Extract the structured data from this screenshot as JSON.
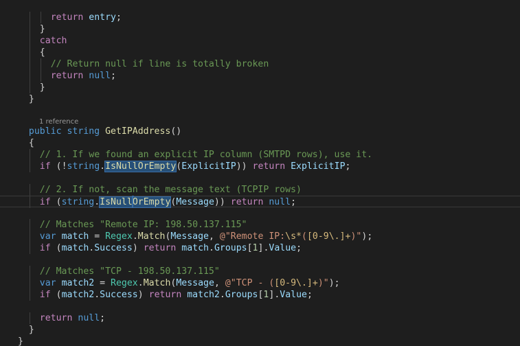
{
  "editor": {
    "codelens": "1 reference",
    "lines": [
      {
        "indent": 6,
        "tokens": [
          [
            "ctl",
            "return"
          ],
          [
            "pl",
            " "
          ],
          [
            "var",
            "entry"
          ],
          [
            "pl",
            ";"
          ]
        ]
      },
      {
        "indent": 4,
        "tokens": [
          [
            "pl",
            "}"
          ]
        ]
      },
      {
        "indent": 4,
        "tokens": [
          [
            "ctl",
            "catch"
          ]
        ]
      },
      {
        "indent": 4,
        "tokens": [
          [
            "pl",
            "{"
          ]
        ]
      },
      {
        "indent": 6,
        "tokens": [
          [
            "cm",
            "// Return null if line is totally broken"
          ]
        ]
      },
      {
        "indent": 6,
        "tokens": [
          [
            "ctl",
            "return"
          ],
          [
            "pl",
            " "
          ],
          [
            "kw",
            "null"
          ],
          [
            "pl",
            ";"
          ]
        ]
      },
      {
        "indent": 4,
        "tokens": [
          [
            "pl",
            "}"
          ]
        ]
      },
      {
        "indent": 2,
        "tokens": [
          [
            "pl",
            "}"
          ]
        ]
      },
      {
        "indent": 0,
        "tokens": []
      },
      {
        "indent": 0,
        "tokens": []
      },
      {
        "indent": 2,
        "tokens": [
          [
            "kw",
            "public"
          ],
          [
            "pl",
            " "
          ],
          [
            "kw",
            "string"
          ],
          [
            "pl",
            " "
          ],
          [
            "fn",
            "GetIPAddress"
          ],
          [
            "pl",
            "()"
          ]
        ]
      },
      {
        "indent": 2,
        "tokens": [
          [
            "pl",
            "{"
          ]
        ]
      },
      {
        "indent": 4,
        "tokens": [
          [
            "cm",
            "// 1. If we found an explicit IP column (SMTPD rows), use it."
          ]
        ]
      },
      {
        "indent": 4,
        "tokens": [
          [
            "ctl",
            "if"
          ],
          [
            "pl",
            " (!"
          ],
          [
            "kw",
            "string"
          ],
          [
            "pl",
            "."
          ],
          [
            "fn hl",
            "IsNullOrEmpty"
          ],
          [
            "pl",
            "("
          ],
          [
            "var",
            "ExplicitIP"
          ],
          [
            "pl",
            ")) "
          ],
          [
            "ctl",
            "return"
          ],
          [
            "pl",
            " "
          ],
          [
            "var",
            "ExplicitIP"
          ],
          [
            "pl",
            ";"
          ]
        ]
      },
      {
        "indent": 0,
        "tokens": []
      },
      {
        "indent": 4,
        "tokens": [
          [
            "cm",
            "// 2. If not, scan the message text (TCPIP rows)"
          ]
        ]
      },
      {
        "indent": 4,
        "current": true,
        "tokens": [
          [
            "ctl",
            "if"
          ],
          [
            "pl",
            " ("
          ],
          [
            "kw",
            "string"
          ],
          [
            "pl",
            "."
          ],
          [
            "fn hl",
            "IsNull"
          ],
          [
            "caret",
            ""
          ],
          [
            "fn hl",
            "OrEmpty"
          ],
          [
            "pl",
            "("
          ],
          [
            "var",
            "Message"
          ],
          [
            "pl",
            ")) "
          ],
          [
            "ctl",
            "return"
          ],
          [
            "pl",
            " "
          ],
          [
            "kw",
            "null"
          ],
          [
            "pl",
            ";"
          ]
        ]
      },
      {
        "indent": 0,
        "tokens": []
      },
      {
        "indent": 4,
        "tokens": [
          [
            "cm",
            "// Matches \"Remote IP: 198.50.137.115\""
          ]
        ]
      },
      {
        "indent": 4,
        "tokens": [
          [
            "kw",
            "var"
          ],
          [
            "pl",
            " "
          ],
          [
            "var",
            "match"
          ],
          [
            "pl",
            " = "
          ],
          [
            "ty",
            "Regex"
          ],
          [
            "pl",
            "."
          ],
          [
            "fn",
            "Match"
          ],
          [
            "pl",
            "("
          ],
          [
            "var",
            "Message"
          ],
          [
            "pl",
            ", "
          ],
          [
            "str",
            "@\"Remote IP:"
          ],
          [
            "esc",
            "\\s*"
          ],
          [
            "str",
            "("
          ],
          [
            "esc",
            "[0-9\\.]+"
          ],
          [
            "str",
            ")\""
          ],
          [
            "pl",
            ");"
          ]
        ]
      },
      {
        "indent": 4,
        "tokens": [
          [
            "ctl",
            "if"
          ],
          [
            "pl",
            " ("
          ],
          [
            "var",
            "match"
          ],
          [
            "pl",
            "."
          ],
          [
            "var",
            "Success"
          ],
          [
            "pl",
            ") "
          ],
          [
            "ctl",
            "return"
          ],
          [
            "pl",
            " "
          ],
          [
            "var",
            "match"
          ],
          [
            "pl",
            "."
          ],
          [
            "var",
            "Groups"
          ],
          [
            "pl",
            "["
          ],
          [
            "num",
            "1"
          ],
          [
            "pl",
            "]."
          ],
          [
            "var",
            "Value"
          ],
          [
            "pl",
            ";"
          ]
        ]
      },
      {
        "indent": 0,
        "tokens": []
      },
      {
        "indent": 4,
        "tokens": [
          [
            "cm",
            "// Matches \"TCP - 198.50.137.115\""
          ]
        ]
      },
      {
        "indent": 4,
        "tokens": [
          [
            "kw",
            "var"
          ],
          [
            "pl",
            " "
          ],
          [
            "var",
            "match2"
          ],
          [
            "pl",
            " = "
          ],
          [
            "ty",
            "Regex"
          ],
          [
            "pl",
            "."
          ],
          [
            "fn",
            "Match"
          ],
          [
            "pl",
            "("
          ],
          [
            "var",
            "Message"
          ],
          [
            "pl",
            ", "
          ],
          [
            "str",
            "@\"TCP - ("
          ],
          [
            "esc",
            "[0-9\\.]+"
          ],
          [
            "str",
            ")\""
          ],
          [
            "pl",
            ");"
          ]
        ]
      },
      {
        "indent": 4,
        "tokens": [
          [
            "ctl",
            "if"
          ],
          [
            "pl",
            " ("
          ],
          [
            "var",
            "match2"
          ],
          [
            "pl",
            "."
          ],
          [
            "var",
            "Success"
          ],
          [
            "pl",
            ") "
          ],
          [
            "ctl",
            "return"
          ],
          [
            "pl",
            " "
          ],
          [
            "var",
            "match2"
          ],
          [
            "pl",
            "."
          ],
          [
            "var",
            "Groups"
          ],
          [
            "pl",
            "["
          ],
          [
            "num",
            "1"
          ],
          [
            "pl",
            "]."
          ],
          [
            "var",
            "Value"
          ],
          [
            "pl",
            ";"
          ]
        ]
      },
      {
        "indent": 0,
        "tokens": []
      },
      {
        "indent": 4,
        "tokens": [
          [
            "ctl",
            "return"
          ],
          [
            "pl",
            " "
          ],
          [
            "kw",
            "null"
          ],
          [
            "pl",
            ";"
          ]
        ]
      },
      {
        "indent": 2,
        "tokens": [
          [
            "pl",
            "}"
          ]
        ]
      },
      {
        "indent": 0,
        "tokens": [
          [
            "pl",
            "}"
          ]
        ]
      }
    ]
  }
}
